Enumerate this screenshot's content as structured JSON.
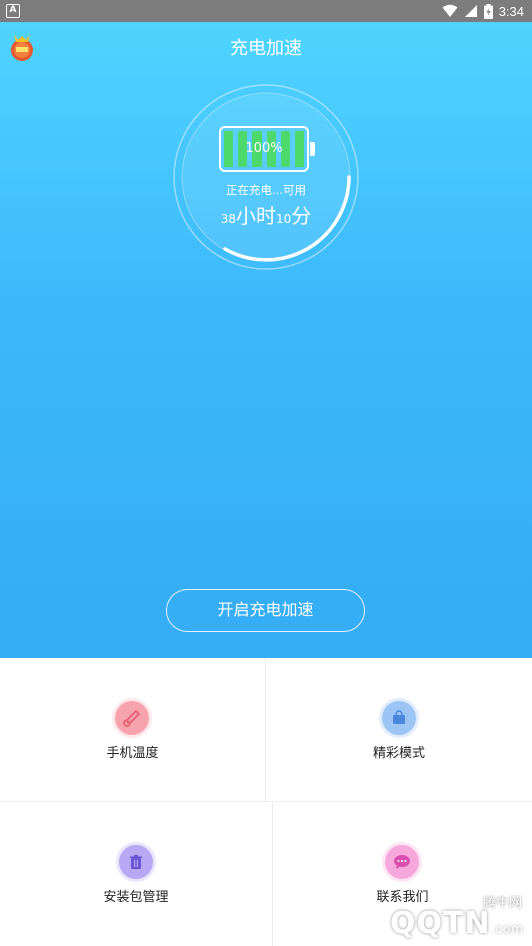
{
  "status_bar": {
    "time": "3:34",
    "left_icon": "A"
  },
  "app": {
    "title": "充电加速"
  },
  "battery": {
    "percent_label": "100%",
    "level": 1.0,
    "charging_text": "正在充电...可用",
    "hours": "38",
    "hours_unit": "小时",
    "minutes": "10",
    "minutes_unit": "分",
    "cell_color": "#4dd96b"
  },
  "boost_button": {
    "label": "开启充电加速"
  },
  "features": [
    {
      "label": "手机温度",
      "icon": "thermometer-icon",
      "color": "#f7a3ad"
    },
    {
      "label": "精彩模式",
      "icon": "shopping-bag-icon",
      "color": "#9cc4f5"
    },
    {
      "label": "安装包管理",
      "icon": "trash-icon",
      "color": "#b6a8f2"
    },
    {
      "label": "联系我们",
      "icon": "chat-bubble-icon",
      "color": "#f6a8dc"
    }
  ],
  "watermark": {
    "site": "腾牛网",
    "brand": "QQTN",
    "suffix": ".com"
  },
  "colors": {
    "hero_top": "#4fd4ff",
    "hero_bottom": "#35acf5"
  }
}
